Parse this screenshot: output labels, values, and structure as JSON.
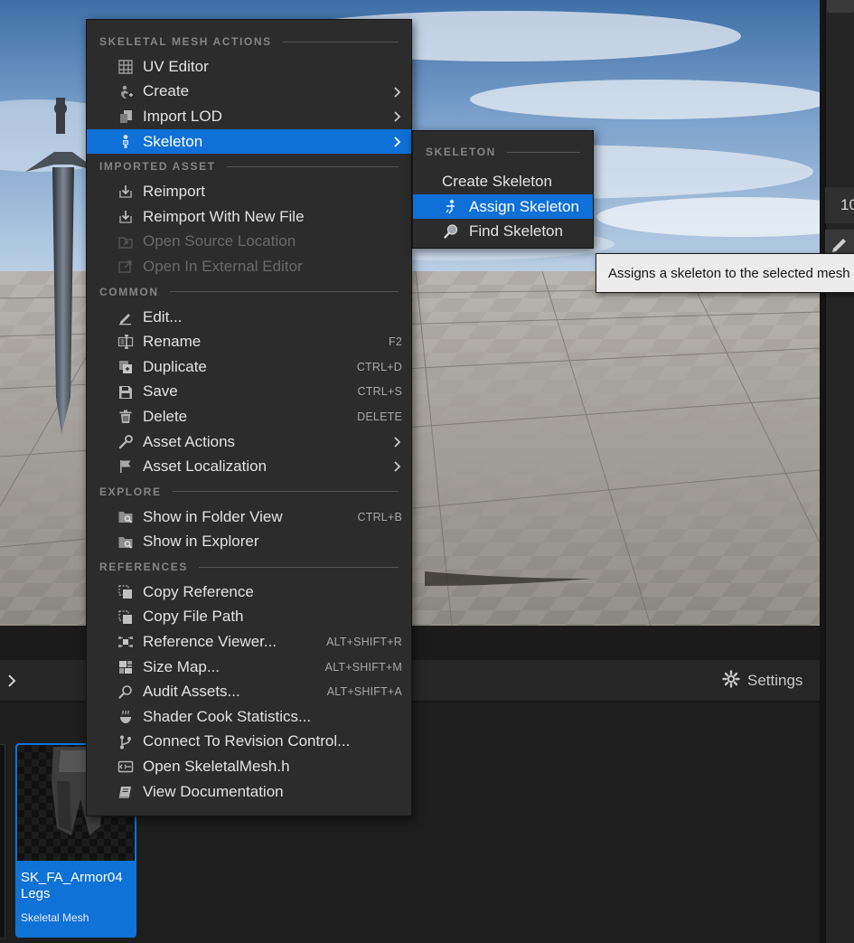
{
  "context_menu": {
    "sections": {
      "skeletal_mesh_actions": "SKELETAL MESH ACTIONS",
      "imported_asset": "IMPORTED ASSET",
      "common": "COMMON",
      "explore": "EXPLORE",
      "references": "REFERENCES"
    },
    "items": {
      "uv_editor": "UV Editor",
      "create": "Create",
      "import_lod": "Import LOD",
      "skeleton": "Skeleton",
      "reimport": "Reimport",
      "reimport_new_file": "Reimport With New File",
      "open_source_location": "Open Source Location",
      "open_external_editor": "Open In External Editor",
      "edit": "Edit...",
      "rename": "Rename",
      "duplicate": "Duplicate",
      "save": "Save",
      "delete": "Delete",
      "asset_actions": "Asset Actions",
      "asset_localization": "Asset Localization",
      "show_folder_view": "Show in Folder View",
      "show_explorer": "Show in Explorer",
      "copy_reference": "Copy Reference",
      "copy_file_path": "Copy File Path",
      "reference_viewer": "Reference Viewer...",
      "size_map": "Size Map...",
      "audit_assets": "Audit Assets...",
      "shader_cook_stats": "Shader Cook Statistics...",
      "connect_revision": "Connect To Revision Control...",
      "open_header": "Open SkeletalMesh.h",
      "view_docs": "View Documentation"
    },
    "shortcuts": {
      "rename": "F2",
      "duplicate": "CTRL+D",
      "save": "CTRL+S",
      "delete": "DELETE",
      "show_folder_view": "CTRL+B",
      "reference_viewer": "ALT+SHIFT+R",
      "size_map": "ALT+SHIFT+M",
      "audit_assets": "ALT+SHIFT+A"
    },
    "highlighted_item": "Skeleton"
  },
  "skeleton_submenu": {
    "section": "SKELETON",
    "items": {
      "create_skeleton": "Create Skeleton",
      "assign_skeleton": "Assign Skeleton",
      "find_skeleton": "Find Skeleton"
    },
    "highlighted_item": "Assign Skeleton"
  },
  "tooltip": {
    "text": "Assigns a skeleton to the selected mesh"
  },
  "content_browser": {
    "settings_label": "Settings",
    "selected_asset": {
      "name": "SK_FA_Armor04 Legs",
      "type": "Skeletal Mesh"
    }
  },
  "details_panel": {
    "partial_value": "10"
  },
  "colors": {
    "accent": "#0f70d7",
    "menu_bg": "#2c2c2c",
    "tooltip_bg": "#ececec"
  },
  "icons": {
    "settings": "gear-icon",
    "submenu_arrow": "chevron-right-icon"
  }
}
